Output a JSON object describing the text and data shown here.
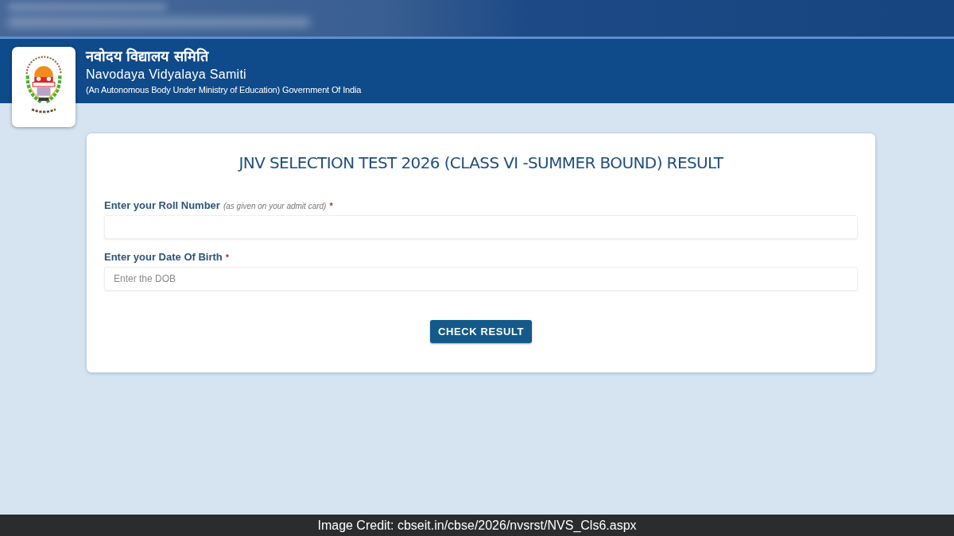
{
  "header": {
    "title_hindi": "नवोदय विद्यालय समिति",
    "title": "Navodaya Vidyalaya Samiti",
    "subtitle": "(An Autonomous Body Under Ministry of Education) Government Of India"
  },
  "form": {
    "title": "JNV SELECTION TEST 2026 (CLASS VI -SUMMER BOUND) RESULT",
    "fields": [
      {
        "label": "Enter your Roll Number",
        "hint": "(as given on your admit card)",
        "required_mark": "*"
      },
      {
        "label": "Enter your Date Of Birth",
        "required_mark": "*",
        "placeholder": "Enter the DOB"
      }
    ],
    "button": "CHECK RESULT"
  },
  "image_credit": "Image Credit: cbseit.in/cbse/2026/nvsrst/NVS_Cls6.aspx"
}
